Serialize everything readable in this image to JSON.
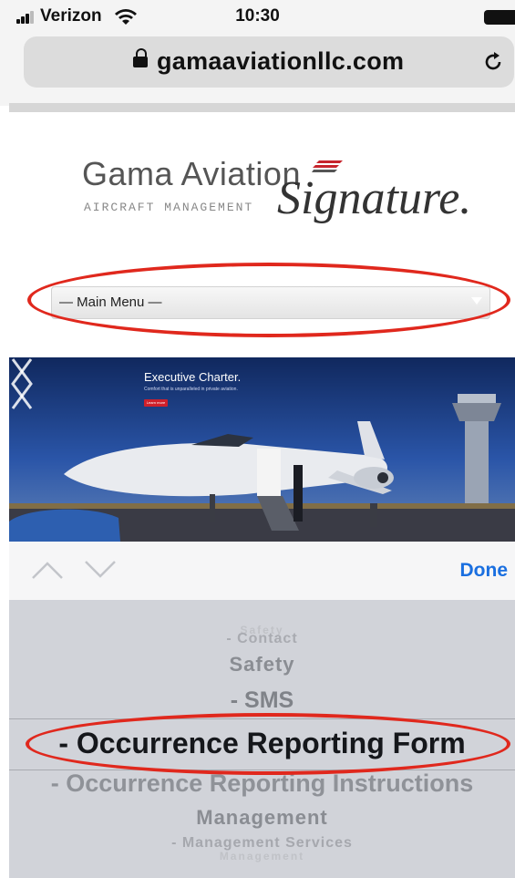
{
  "status_bar": {
    "carrier": "Verizon",
    "time": "10:30"
  },
  "browser": {
    "domain": "gamaaviationllc.com"
  },
  "logo": {
    "name": "Gama Aviation",
    "tagline": "AIRCRAFT MANAGEMENT",
    "signature": "Signature."
  },
  "main_menu": {
    "selected": "— Main Menu —"
  },
  "hero": {
    "headline": "Executive Charter.",
    "subline": "Comfort that is unparalleled in private aviation.",
    "cta": "Learn more"
  },
  "picker_toolbar": {
    "done_label": "Done"
  },
  "picker": {
    "options": [
      "- Contact",
      "Safety",
      "- SMS",
      "- Occurrence Reporting Form",
      "- Occurrence Reporting Instructions",
      "Management",
      "- Management Services"
    ],
    "selected_index": 3
  },
  "colors": {
    "annotation_red": "#e0281d",
    "done_blue": "#1a6fe0",
    "picker_bg": "#d1d3d9"
  }
}
